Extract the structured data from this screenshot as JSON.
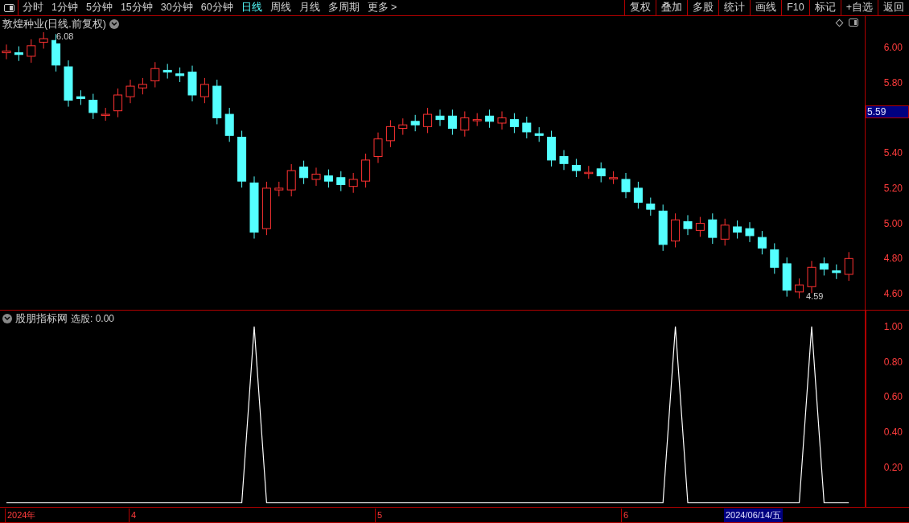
{
  "toolbar": {
    "periods": [
      {
        "label": "分时",
        "selected": false
      },
      {
        "label": "1分钟",
        "selected": false
      },
      {
        "label": "5分钟",
        "selected": false
      },
      {
        "label": "15分钟",
        "selected": false
      },
      {
        "label": "30分钟",
        "selected": false
      },
      {
        "label": "60分钟",
        "selected": false
      },
      {
        "label": "日线",
        "selected": true
      },
      {
        "label": "周线",
        "selected": false
      },
      {
        "label": "月线",
        "selected": false
      },
      {
        "label": "多周期",
        "selected": false
      },
      {
        "label": "更多 >",
        "selected": false
      }
    ],
    "actions": [
      "复权",
      "叠加",
      "多股",
      "统计",
      "画线",
      "F10",
      "标记",
      "+自选",
      "返回"
    ]
  },
  "main_chart": {
    "title": "敦煌种业(日线.前复权)",
    "high_label": "6.08",
    "low_label": "4.59",
    "price_ticks": [
      "6.00",
      "5.80",
      "5.40",
      "5.20",
      "5.00",
      "4.80",
      "4.60"
    ],
    "current_price": "5.59"
  },
  "indicator": {
    "title": "股朋指标网",
    "reading": "0.00",
    "chart_data": {
      "type": "line",
      "ylim": [
        -0.024,
        1.091
      ],
      "yticks": [
        {
          "value": 1,
          "label": "1.00"
        },
        {
          "value": 0.8,
          "label": "0.80"
        },
        {
          "value": 0.6,
          "label": "0.60"
        },
        {
          "value": 0.4,
          "label": "0.40"
        },
        {
          "value": 0.2,
          "label": "0.20"
        }
      ],
      "series": [
        {
          "name": "选股:",
          "color": "#ffffff",
          "values": [
            0,
            0,
            0,
            0,
            0,
            0,
            0,
            0,
            0,
            0,
            0,
            0,
            0,
            0,
            0,
            0,
            0,
            0,
            0,
            0,
            1,
            0,
            0,
            0,
            0,
            0,
            0,
            0,
            0,
            0,
            0,
            0,
            0,
            0,
            0,
            0,
            0,
            0,
            0,
            0,
            0,
            0,
            0,
            0,
            0,
            0,
            0,
            0,
            0,
            0,
            0,
            0,
            0,
            0,
            1,
            0,
            0,
            0,
            0,
            0,
            0,
            0,
            0,
            0,
            0,
            1,
            0,
            0,
            0
          ]
        }
      ]
    }
  },
  "date_axis": {
    "labels": [
      "2024年",
      "4",
      "5",
      "6"
    ],
    "cursor_date": "2024/06/14/五"
  }
}
